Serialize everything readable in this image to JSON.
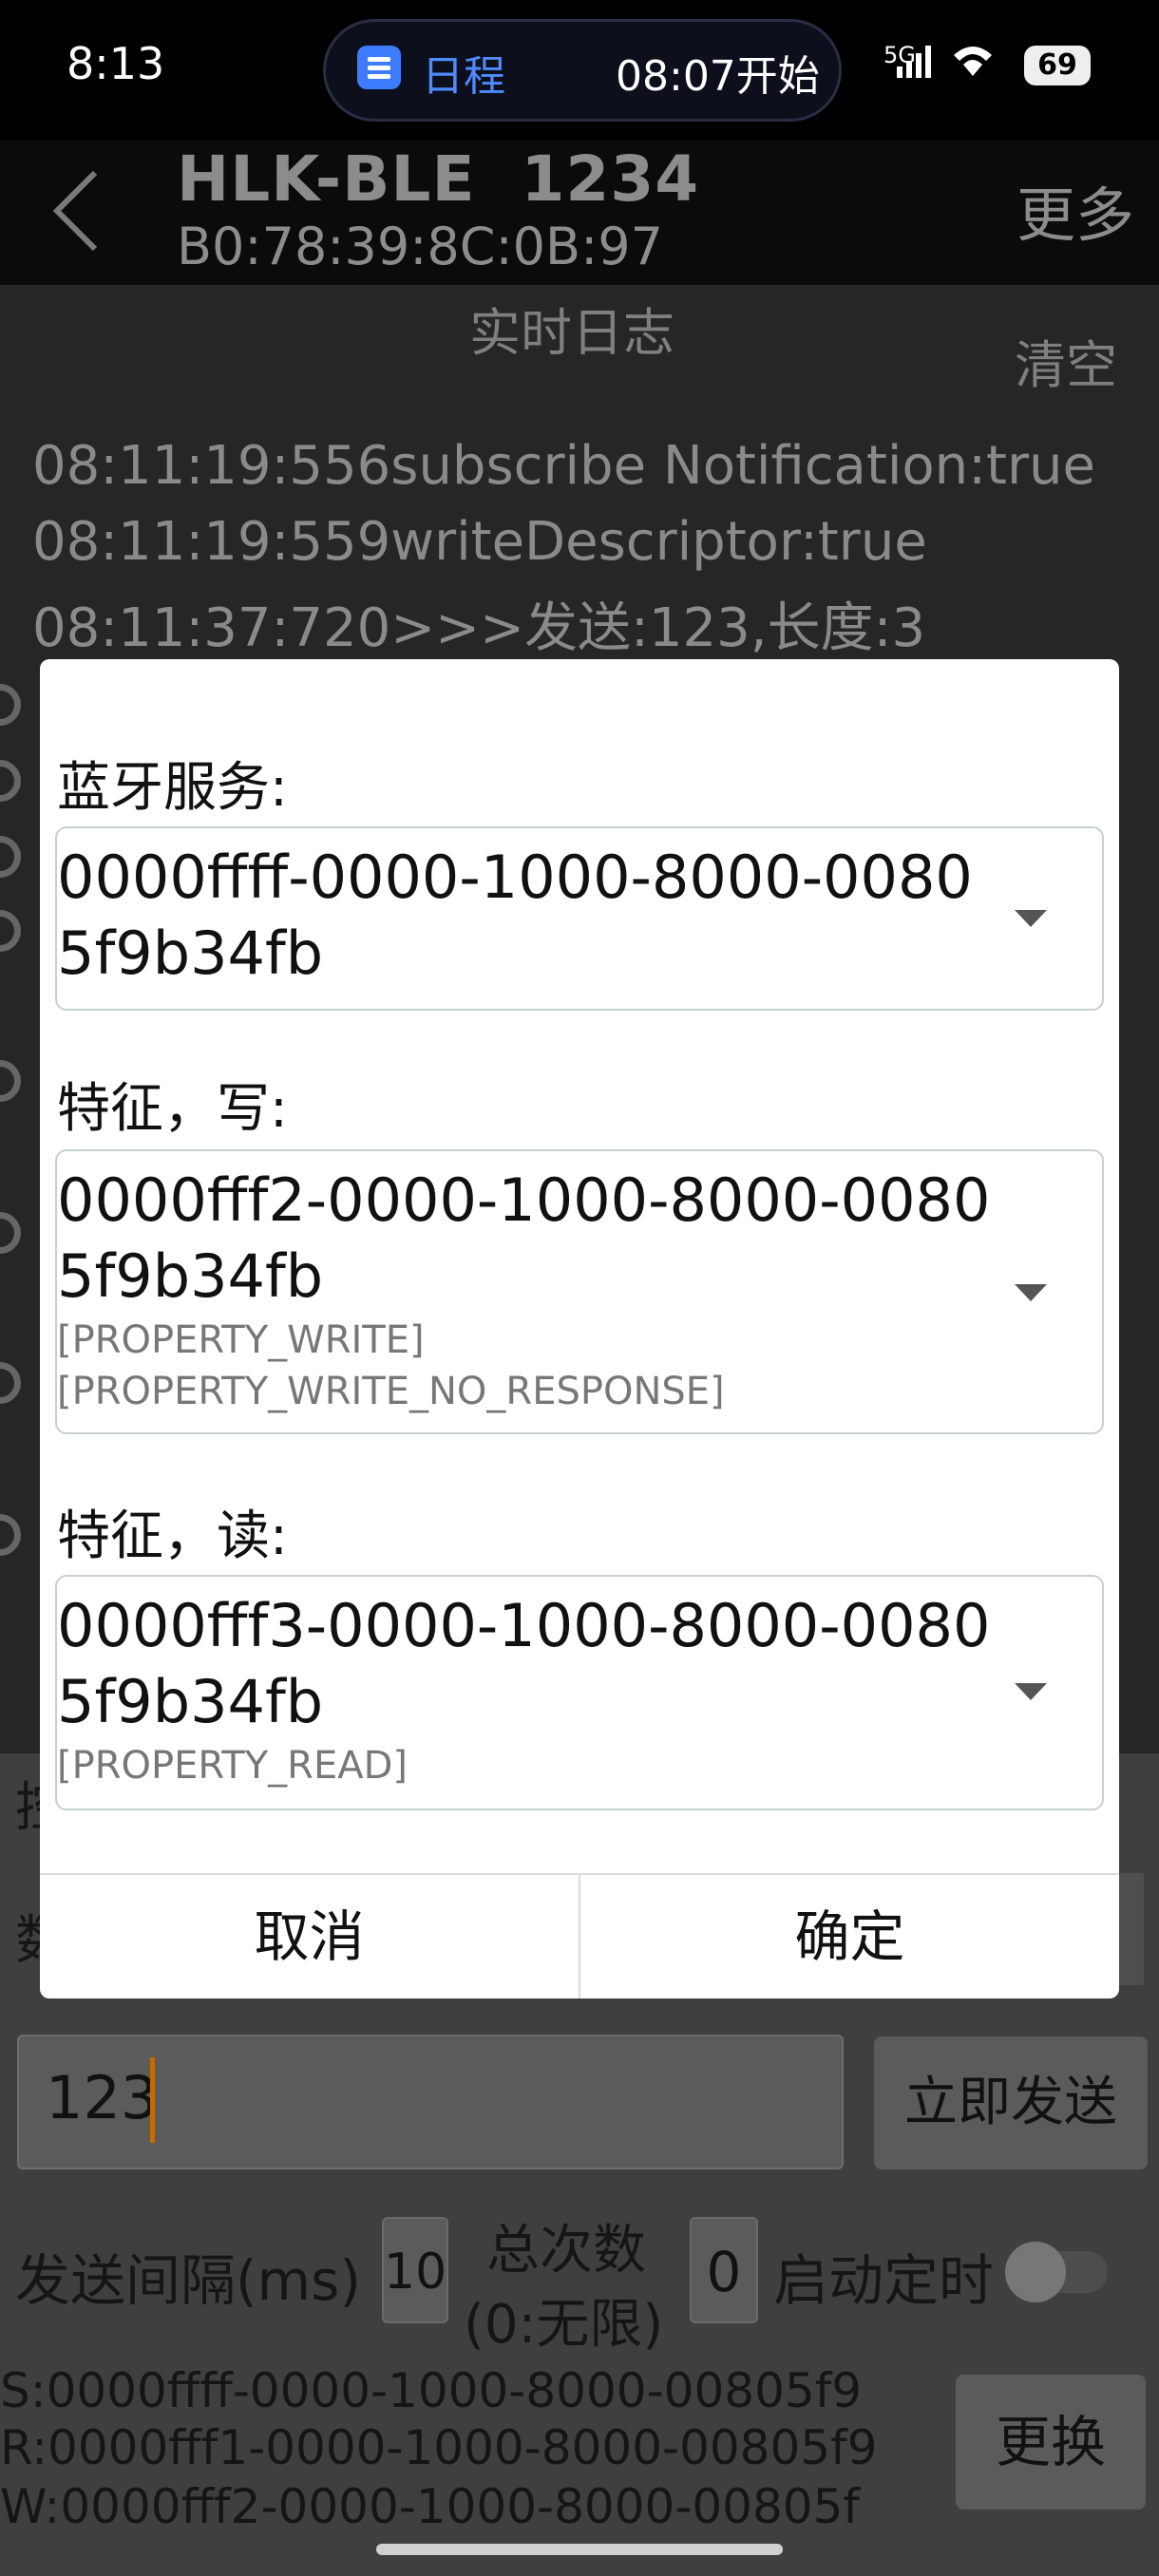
{
  "status_bar": {
    "time": "8:13",
    "pill_label": "日程",
    "pill_time": "08:07开始",
    "signal": "5G",
    "battery": "69"
  },
  "header": {
    "title": "HLK-BLE  1234",
    "mac": "B0:78:39:8C:0B:97",
    "more": "更多"
  },
  "log": {
    "title": "实时日志",
    "clear": "清空",
    "lines": [
      "08:11:19:556subscribe Notification:true",
      "08:11:19:559writeDescriptor:true",
      "08:11:37:720>>>发送:123,长度:3"
    ]
  },
  "dialog": {
    "service_label": "蓝牙服务:",
    "service_uuid": "0000ffff-0000-1000-8000-00805f9b34fb",
    "write_label": "特征，写:",
    "write_uuid": "0000fff2-0000-1000-8000-00805f9b34fb",
    "write_props": [
      "[PROPERTY_WRITE]",
      "[PROPERTY_WRITE_NO_RESPONSE]"
    ],
    "read_label": "特征，读:",
    "read_uuid": "0000fff3-0000-1000-8000-00805f9b34fb",
    "read_props": [
      "[PROPERTY_READ]"
    ],
    "cancel": "取消",
    "confirm": "确定"
  },
  "send_panel": {
    "partial_label_1": "控",
    "partial_label_2": "数",
    "input_value": "123",
    "send_button": "立即发送",
    "interval_label": "发送间隔(ms)",
    "interval_value": "10",
    "total_label_1": "总次数",
    "total_label_2": "(0:无限)",
    "total_value": "0",
    "timer_label": "启动定时",
    "uuid_lines": [
      "S:0000ffff-0000-1000-8000-00805f9",
      "R:0000fff1-0000-1000-8000-00805f9",
      "W:0000fff2-0000-1000-8000-00805f"
    ],
    "change_button": "更换"
  },
  "colors": {
    "accent_blue": "#3d7bff",
    "caret": "#c46a00",
    "dialog_bg": "#ffffff"
  }
}
